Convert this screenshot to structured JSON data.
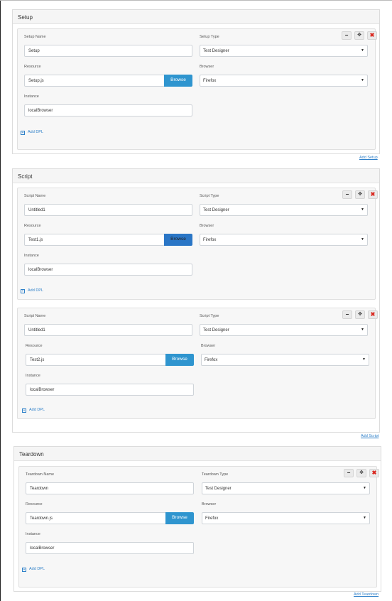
{
  "colors": {
    "accent": "#2f95cf",
    "link": "#2f80c9",
    "close": "#d9241c"
  },
  "icons": {
    "minimize": "minus-icon",
    "maximize": "expand-icon",
    "close": "close-x-icon",
    "add": "plus-square-icon"
  },
  "setup": {
    "title": "Setup",
    "add_link": "Add Setup",
    "cards": [
      {
        "name_label": "Setup Name",
        "name_value": "Setup",
        "type_label": "Setup Type",
        "type_value": "Test Designer",
        "resource_label": "Resource",
        "resource_value": "Setup.js",
        "browser_label": "Browser",
        "browser_value": "Firefox",
        "instance_label": "Instance",
        "instance_value": "localBrowser",
        "add_dpl": "Add DPL",
        "browse_label": "Browse"
      }
    ]
  },
  "script": {
    "title": "Script",
    "add_link": "Add Script",
    "cards": [
      {
        "name_label": "Script Name",
        "name_value": "Untitled1",
        "type_label": "Script Type",
        "type_value": "Test Designer",
        "resource_label": "Resource",
        "resource_value": "Test1.js",
        "browser_label": "Browser",
        "browser_value": "Firefox",
        "instance_label": "Instance",
        "instance_value": "localBrowser",
        "add_dpl": "Add DPL",
        "browse_label": "Browse"
      },
      {
        "name_label": "Script Name",
        "name_value": "Untitled1",
        "type_label": "Script Type",
        "type_value": "Test Designer",
        "resource_label": "Resource",
        "resource_value": "Test2.js",
        "browser_label": "Browser",
        "browser_value": "Firefox",
        "instance_label": "Instance",
        "instance_value": "localBrowser",
        "add_dpl": "Add DPL",
        "browse_label": "Browse"
      }
    ]
  },
  "teardown": {
    "title": "Teardown",
    "add_link": "Add Teardown",
    "cards": [
      {
        "name_label": "Teardown Name",
        "name_value": "Teardown",
        "type_label": "Teardown Type",
        "type_value": "Test Designer",
        "resource_label": "Resource",
        "resource_value": "Teardown.js",
        "browser_label": "Browser",
        "browser_value": "Firefox",
        "instance_label": "Instance",
        "instance_value": "localBrowser",
        "add_dpl": "Add DPL",
        "browse_label": "Browse"
      }
    ]
  }
}
